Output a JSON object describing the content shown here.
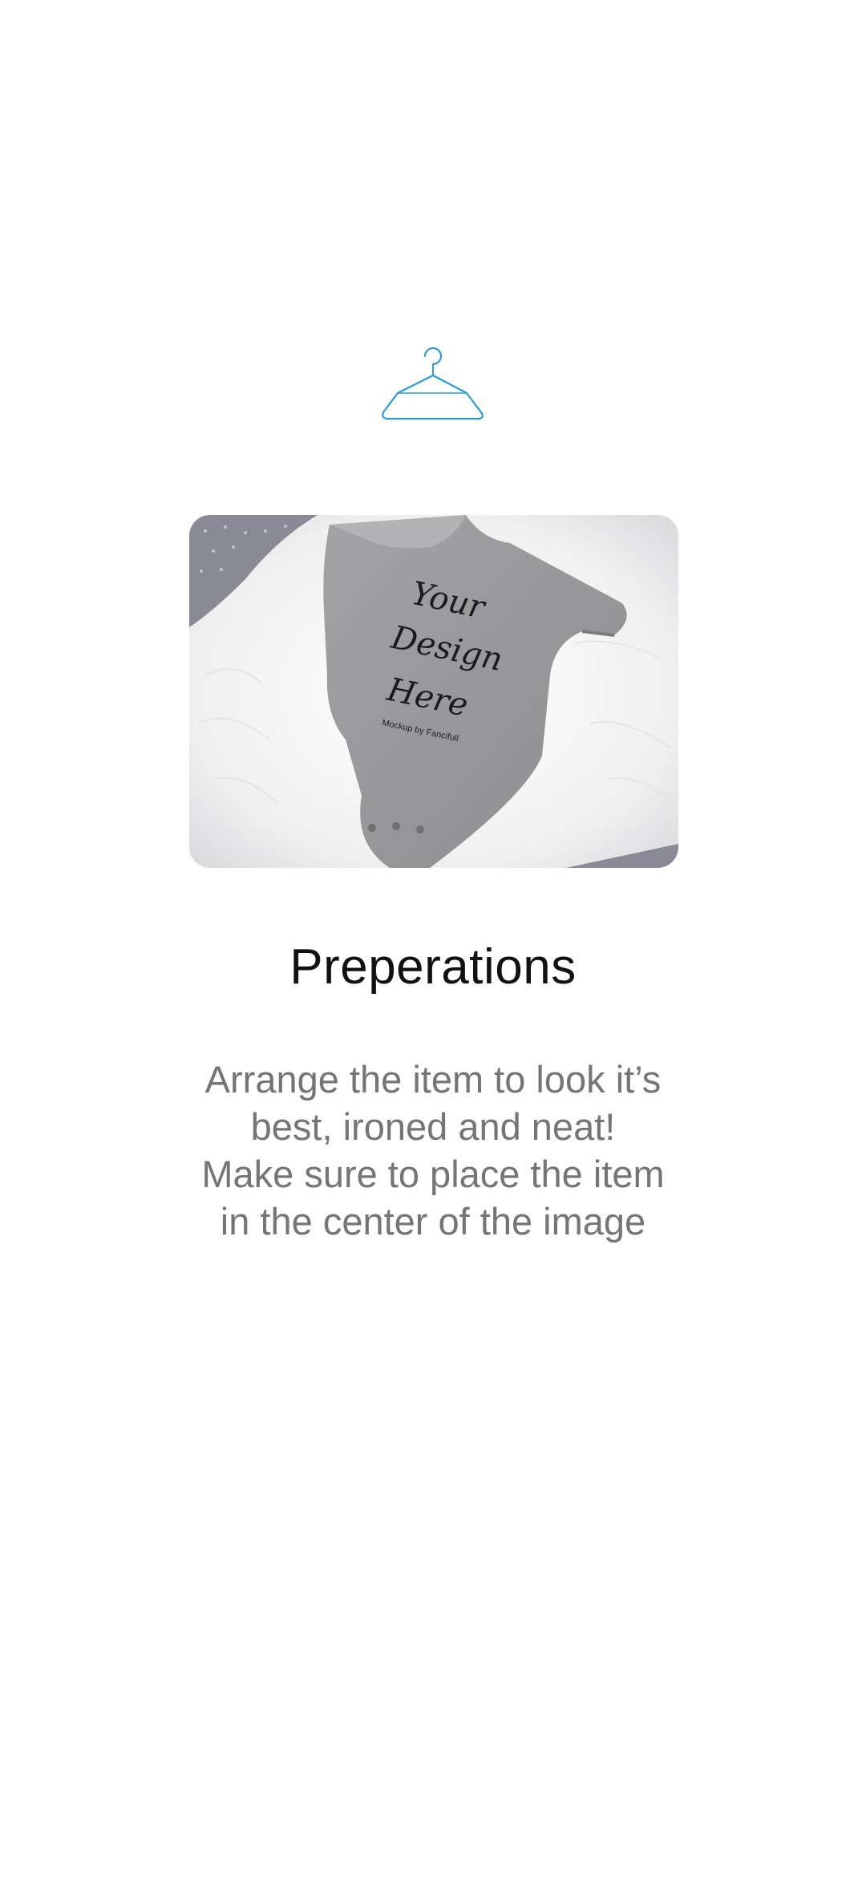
{
  "accent_color": "#2E9BD6",
  "icon": "hanger-icon",
  "photo": {
    "alt": "gray baby onesie on white fur rug",
    "shirt_text": [
      "Your",
      "Design",
      "Here"
    ],
    "watermark": "Mockup by Fancifull"
  },
  "title": "Preperations",
  "description_lines": [
    "Arrange the item to look it’s",
    "best, ironed and neat!",
    "Make sure to place the item",
    "in the center of the image"
  ]
}
